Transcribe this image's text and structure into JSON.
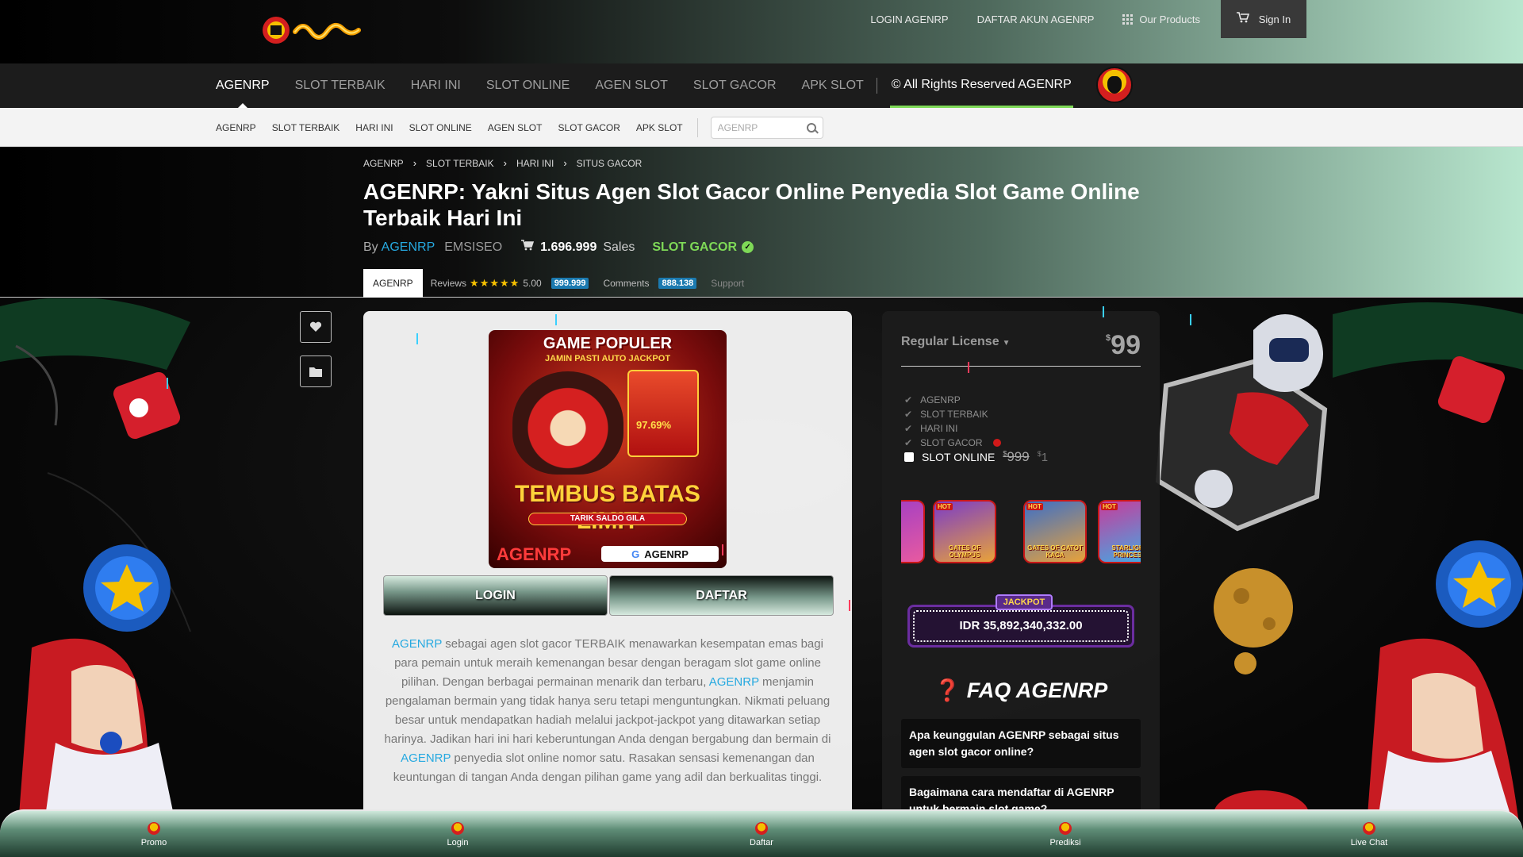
{
  "topbar": {
    "links": [
      "LOGIN AGENRP",
      "DAFTAR AKUN AGENRP"
    ],
    "products_label": "Our Products",
    "signin_label": "Sign In"
  },
  "main_nav": {
    "items": [
      "AGENRP",
      "SLOT TERBAIK",
      "HARI INI",
      "SLOT ONLINE",
      "AGEN SLOT",
      "SLOT GACOR",
      "APK SLOT"
    ],
    "rights": "© All Rights Reserved AGENRP"
  },
  "sub_nav": {
    "items": [
      "AGENRP",
      "SLOT TERBAIK",
      "HARI INI",
      "SLOT ONLINE",
      "AGEN SLOT",
      "SLOT GACOR",
      "APK SLOT"
    ],
    "search_placeholder": "AGENRP"
  },
  "breadcrumb": [
    "AGENRP",
    "SLOT TERBAIK",
    "HARI INI",
    "SITUS GACOR"
  ],
  "title": "AGENRP: Yakni Situs Agen Slot Gacor Online Penyedia Slot Game Online Terbaik Hari Ini",
  "meta": {
    "by": "By",
    "author": "AGENRP",
    "emsi": "EMSISEO",
    "sales_count": "1.696.999",
    "sales_label": "Sales",
    "badge": "SLOT GACOR"
  },
  "tabs": {
    "active": "AGENRP",
    "reviews_label": "Reviews",
    "rating": "5.00",
    "reviews_count": "999.999",
    "comments_label": "Comments",
    "comments_count": "888.138",
    "support_label": "Support"
  },
  "banner": {
    "headline": "GAME POPULER",
    "subline": "JAMIN PASTI AUTO JACKPOT",
    "rtp": "97.69%",
    "main": "TEMBUS BATAS LIMIT",
    "pill": "TARIK SALDO GILA",
    "brand": "AGENRP",
    "brand_box": "AGENRP"
  },
  "cta": {
    "login": "LOGIN",
    "daftar": "DAFTAR"
  },
  "description": {
    "hl1": "AGENRP",
    "t1": " sebagai agen slot gacor TERBAIK menawarkan kesempatan emas bagi para pemain untuk meraih kemenangan besar dengan beragam slot game online pilihan. Dengan berbagai permainan menarik dan terbaru, ",
    "hl2": "AGENRP",
    "t2": " menjamin pengalaman bermain yang tidak hanya seru tetapi menguntungkan. Nikmati peluang besar untuk mendapatkan hadiah melalui jackpot-jackpot yang ditawarkan setiap harinya. Jadikan hari ini hari keberuntungan Anda dengan bergabung dan bermain di ",
    "hl3": "AGENRP",
    "t3": " penyedia slot online nomor satu. Rasakan sensasi kemenangan dan keuntungan di tangan Anda dengan pilihan game yang adil dan berkualitas tinggi."
  },
  "license": {
    "name": "Regular License",
    "price": "99",
    "currency": "$",
    "features": [
      "AGENRP",
      "SLOT TERBAIK",
      "HARI INI",
      "SLOT GACOR"
    ],
    "addon_label": "SLOT ONLINE",
    "addon_old_price": "999",
    "addon_new_price": "1"
  },
  "games": [
    {
      "label": "GATES OF OLYMPUS"
    },
    {
      "label": "GATES OF GATOT KACA"
    },
    {
      "label": "STARLIGHT PRINCESS"
    }
  ],
  "jackpot": {
    "label": "JACKPOT",
    "value": "IDR 35,892,340,332.00"
  },
  "faq": {
    "title": "FAQ AGENRP",
    "items": [
      "Apa keunggulan AGENRP sebagai situs agen slot gacor online?",
      "Bagaimana cara mendaftar di AGENRP untuk bermain slot game?"
    ]
  },
  "bottom_nav": [
    "Promo",
    "Login",
    "Daftar",
    "Prediksi",
    "Live Chat"
  ],
  "colors": {
    "accent_blue": "#26a9e0",
    "accent_green": "#7ed957",
    "danger_red": "#d01919"
  }
}
